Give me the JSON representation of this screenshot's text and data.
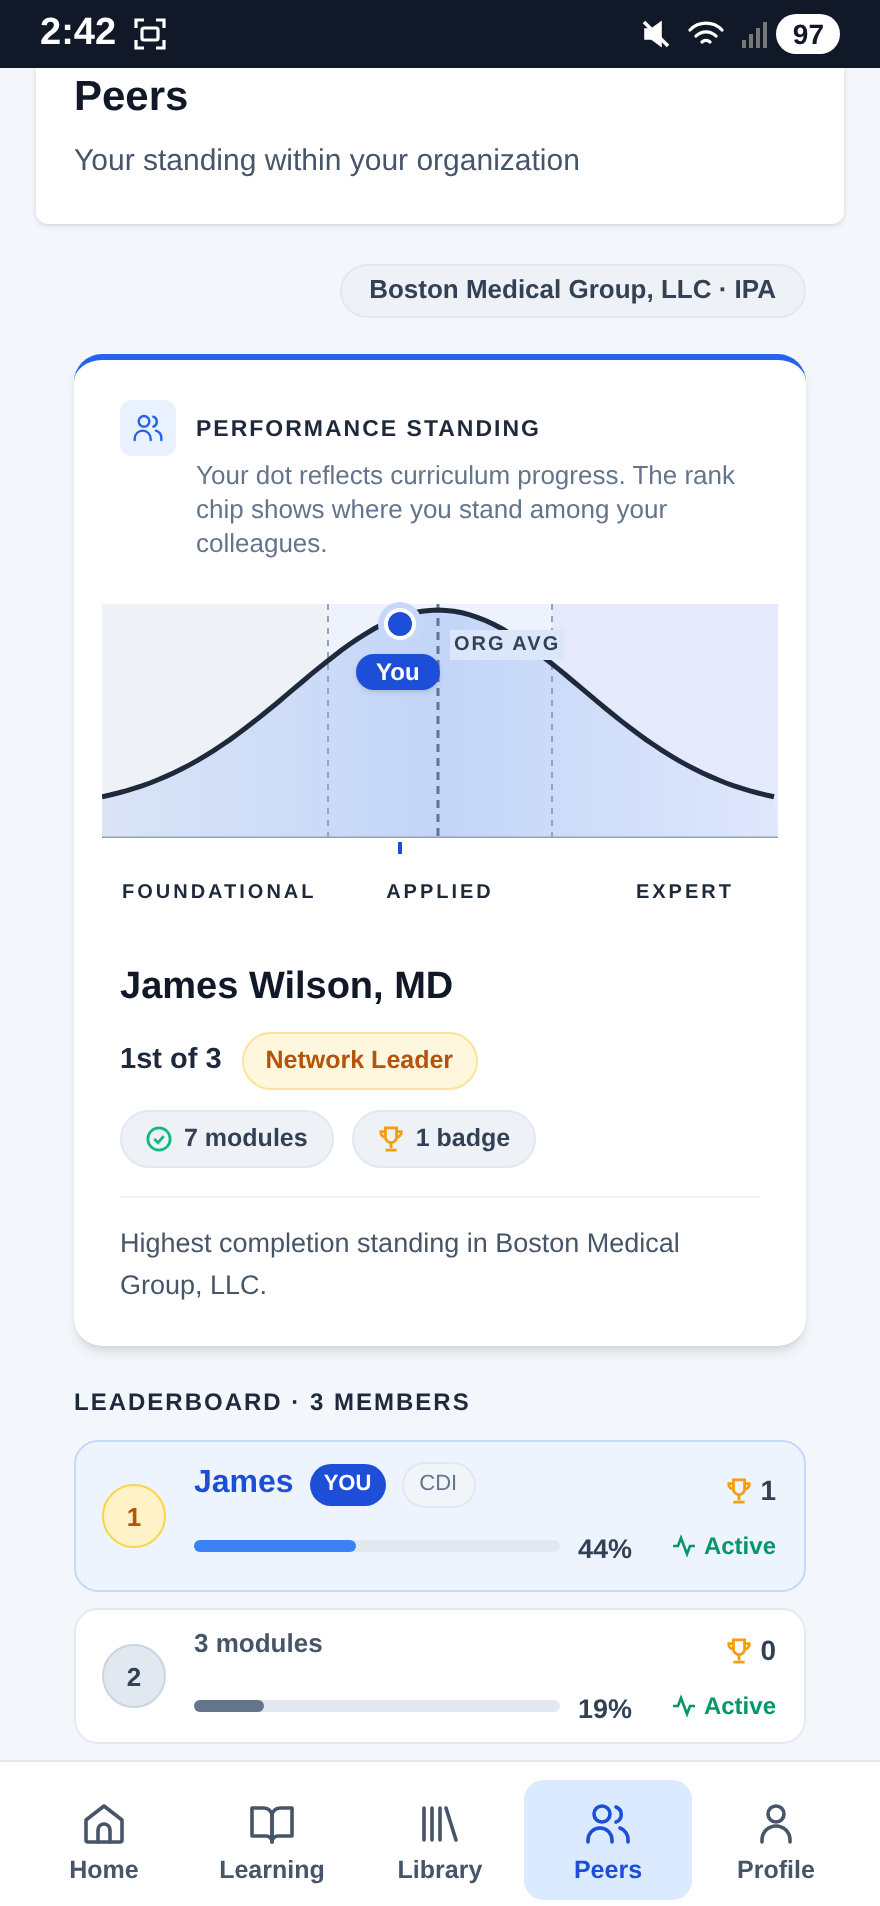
{
  "status_bar": {
    "time": "2:42",
    "battery": "97"
  },
  "header": {
    "title": "Peers",
    "subtitle": "Your standing within your organization"
  },
  "org_chip": {
    "name": "Boston Medical Group, LLC",
    "separator": "·",
    "type": "IPA"
  },
  "standing": {
    "title": "PERFORMANCE STANDING",
    "description": "Your dot reflects curriculum progress. The rank chip shows where you stand among your colleagues.",
    "marker": {
      "label": "You"
    },
    "average_label": "ORG AVG",
    "zones": [
      "FOUNDATIONAL",
      "APPLIED",
      "EXPERT"
    ],
    "name": "James Wilson, MD",
    "rank": "1st of 3",
    "rank_badge": "Network Leader",
    "stats": [
      {
        "kind": "modules",
        "label": "7 modules"
      },
      {
        "kind": "badges",
        "label": "1 badge"
      }
    ],
    "summary": "Highest completion standing in Boston Medical Group, LLC."
  },
  "leaderboard": {
    "title": "LEADERBOARD · 3 MEMBERS",
    "rows": [
      {
        "rank": "1",
        "name": "James",
        "you_badge": "YOU",
        "tag": "CDI",
        "selected": true,
        "trophies": "1",
        "level": 0.44,
        "percent": "44%",
        "status": "Active"
      },
      {
        "rank": "2",
        "subtitle": "3 modules",
        "selected": false,
        "trophies": "0",
        "level": 0.19,
        "percent": "19%",
        "status": "Active"
      }
    ]
  },
  "nav": [
    {
      "label": "Home",
      "selected": false
    },
    {
      "label": "Learning",
      "selected": false
    },
    {
      "label": "Library",
      "selected": false
    },
    {
      "label": "Peers",
      "selected": true
    },
    {
      "label": "Profile",
      "selected": false
    }
  ]
}
